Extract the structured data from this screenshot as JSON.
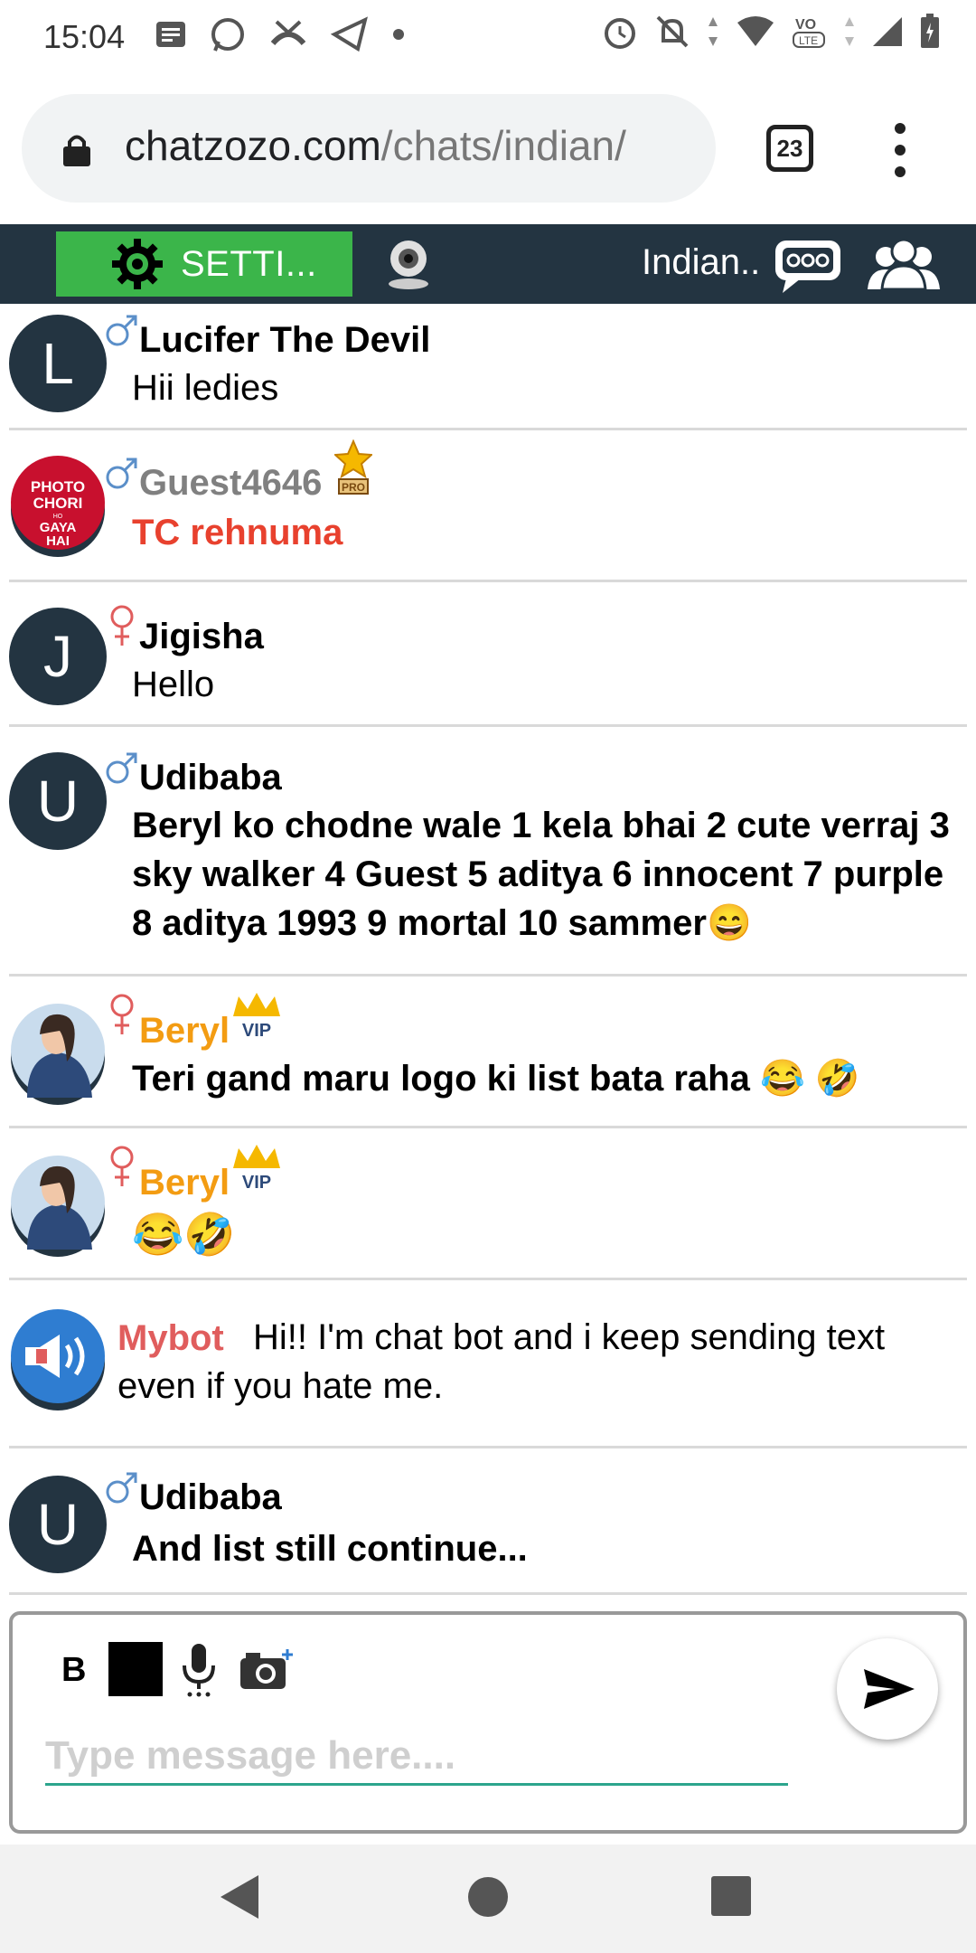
{
  "status_bar": {
    "time": "15:04"
  },
  "browser": {
    "url_domain": "chatzozo.com",
    "url_path": "/chats/indian/",
    "tab_count": "23"
  },
  "chat_header": {
    "settings_label": "SETTI...",
    "room_name": "Indian.."
  },
  "messages": [
    {
      "name": "Lucifer The Devil",
      "text": "Hii ledies",
      "avatar_letter": "L"
    },
    {
      "name": "Guest4646",
      "text": "TC rehnuma",
      "avatar_text": "PHOTO CHORI HO GAYA HAI",
      "badge": "PRO"
    },
    {
      "name": "Jigisha",
      "text": "Hello",
      "avatar_letter": "J"
    },
    {
      "name": "Udibaba",
      "avatar_letter": "U",
      "lines": [
        "Beryl ko chodne wale 1 kela bhai 2 cute verraj 3",
        "sky walker 4 Guest 5 aditya 6 innocent 7 purple",
        "8 aditya 1993 9 mortal 10 sammer😄"
      ]
    },
    {
      "name": "Beryl",
      "text": "Teri gand maru logo ki list bata raha 😂 🤣",
      "badge": "VIP"
    },
    {
      "name": "Beryl",
      "text": "😂🤣",
      "badge": "VIP"
    },
    {
      "name": "Mybot",
      "line1": "Hi!! I'm chat bot and i keep sending text",
      "line2": "even if you hate me."
    },
    {
      "name": "Udibaba",
      "text": "And list still continue...",
      "avatar_letter": "U"
    }
  ],
  "composer": {
    "bold_label": "B",
    "placeholder": "Type message here...."
  },
  "colors": {
    "header_bg": "#233441",
    "settings_green": "#3bb54a",
    "guest_name": "#808080",
    "guest_msg": "#e8412e",
    "vip_name": "#f39c12",
    "bot_name": "#e05d5d",
    "input_underline": "#2ca58d"
  }
}
